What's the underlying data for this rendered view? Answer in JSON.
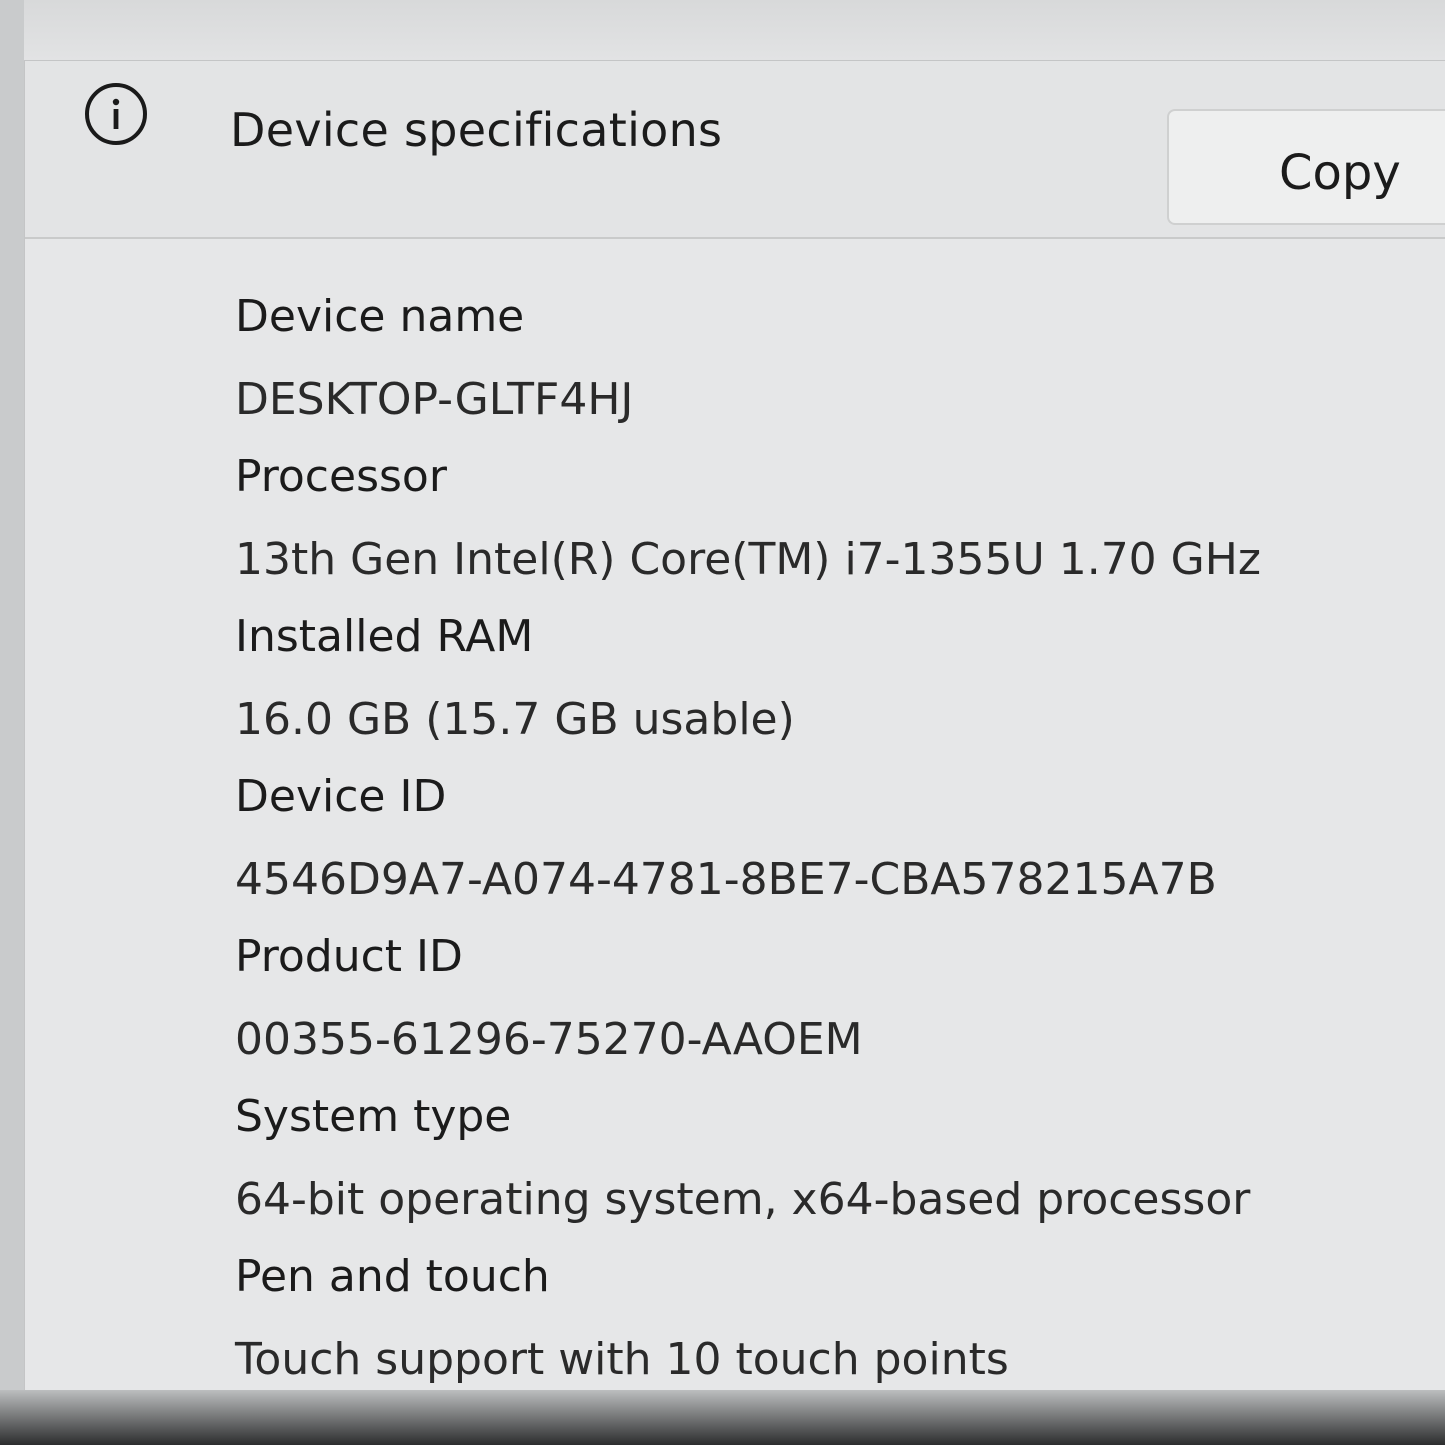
{
  "header": {
    "icon": "info-icon",
    "title": "Device specifications",
    "copy_label": "Copy"
  },
  "specs": [
    {
      "label": "Device name",
      "value": "DESKTOP-GLTF4HJ"
    },
    {
      "label": "Processor",
      "value": "13th Gen Intel(R) Core(TM) i7-1355U   1.70 GHz"
    },
    {
      "label": "Installed RAM",
      "value": "16.0 GB (15.7 GB usable)"
    },
    {
      "label": "Device ID",
      "value": "4546D9A7-A074-4781-8BE7-CBA578215A7B"
    },
    {
      "label": "Product ID",
      "value": "00355-61296-75270-AAOEM"
    },
    {
      "label": "System type",
      "value": "64-bit operating system, x64-based processor"
    },
    {
      "label": "Pen and touch",
      "value": "Touch support with 10 touch points"
    }
  ]
}
